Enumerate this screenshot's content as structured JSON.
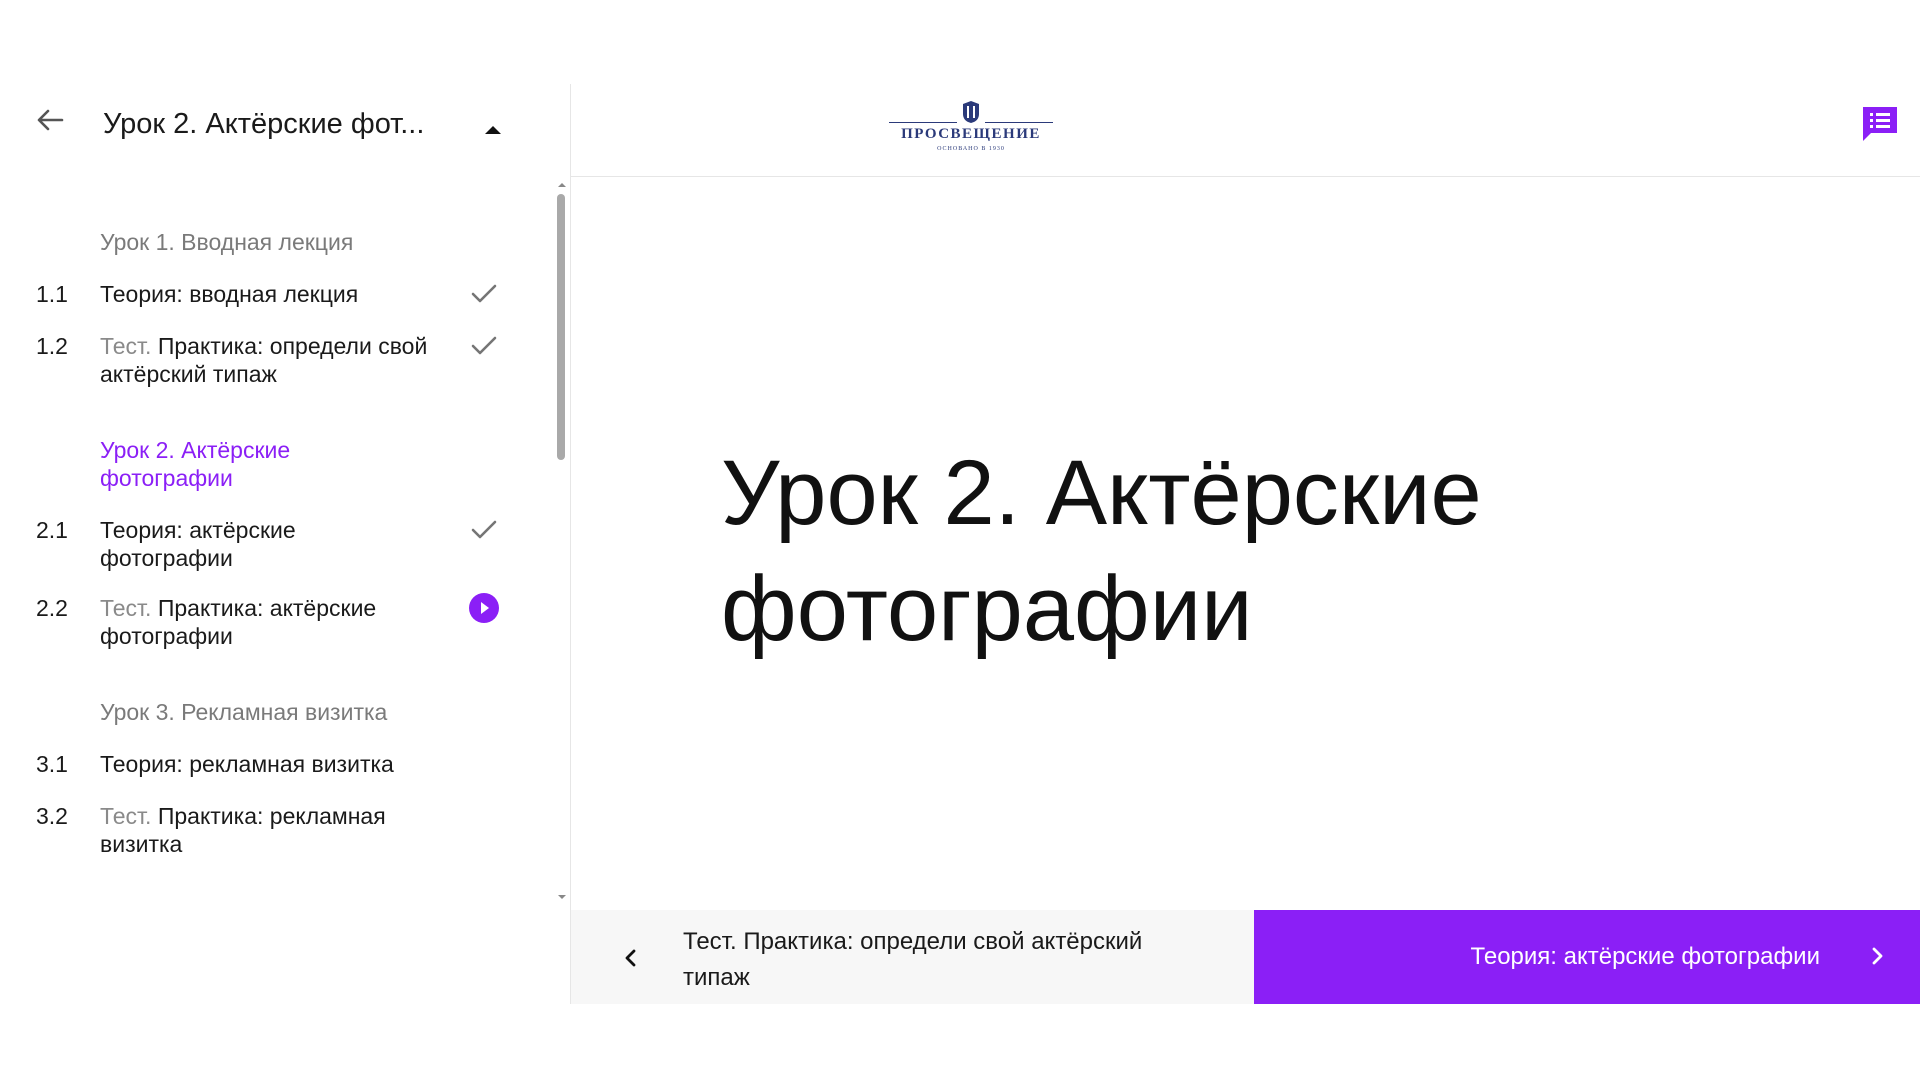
{
  "sidebar": {
    "title": "Урок 2. Актёрские фот...",
    "sections": [
      {
        "title": "Урок 1. Вводная лекция",
        "active": false,
        "items": [
          {
            "num": "1.1",
            "prefix": "",
            "label": "Теория: вводная лекция",
            "status": "done"
          },
          {
            "num": "1.2",
            "prefix": "Тест.",
            "label": "Практика: определи свой актёрский типаж",
            "status": "done"
          }
        ]
      },
      {
        "title": "Урок 2. Актёрские фотографии",
        "active": true,
        "items": [
          {
            "num": "2.1",
            "prefix": "",
            "label": "Теория: актёрские фотографии",
            "status": "done"
          },
          {
            "num": "2.2",
            "prefix": "Тест.",
            "label": "Практика: актёрские фотографии",
            "status": "current"
          }
        ]
      },
      {
        "title": "Урок 3. Рекламная визитка",
        "active": false,
        "items": [
          {
            "num": "3.1",
            "prefix": "",
            "label": "Теория: рекламная визитка",
            "status": "none"
          },
          {
            "num": "3.2",
            "prefix": "Тест.",
            "label": "Практика: рекламная визитка",
            "status": "none"
          }
        ]
      }
    ]
  },
  "header": {
    "logo_text": "ПРОСВЕЩЕНИЕ",
    "logo_subtext": "ОСНОВАНО В 1930"
  },
  "main": {
    "heading": "Урок 2. Актёрские фотографии"
  },
  "footer": {
    "prev_label": "Тест. Практика: определи свой актёрский типаж",
    "next_label": "Теория: актёрские фотографии"
  },
  "colors": {
    "accent": "#8b1ff6",
    "done_check": "#757575",
    "logo": "#2b3a7a"
  },
  "icons": {
    "back": "arrow-left-icon",
    "collapse": "caret-up-icon",
    "toc": "list-chat-icon",
    "done": "check-icon",
    "current": "play-circle-icon",
    "prev": "chevron-left-icon",
    "next": "chevron-right-icon"
  }
}
